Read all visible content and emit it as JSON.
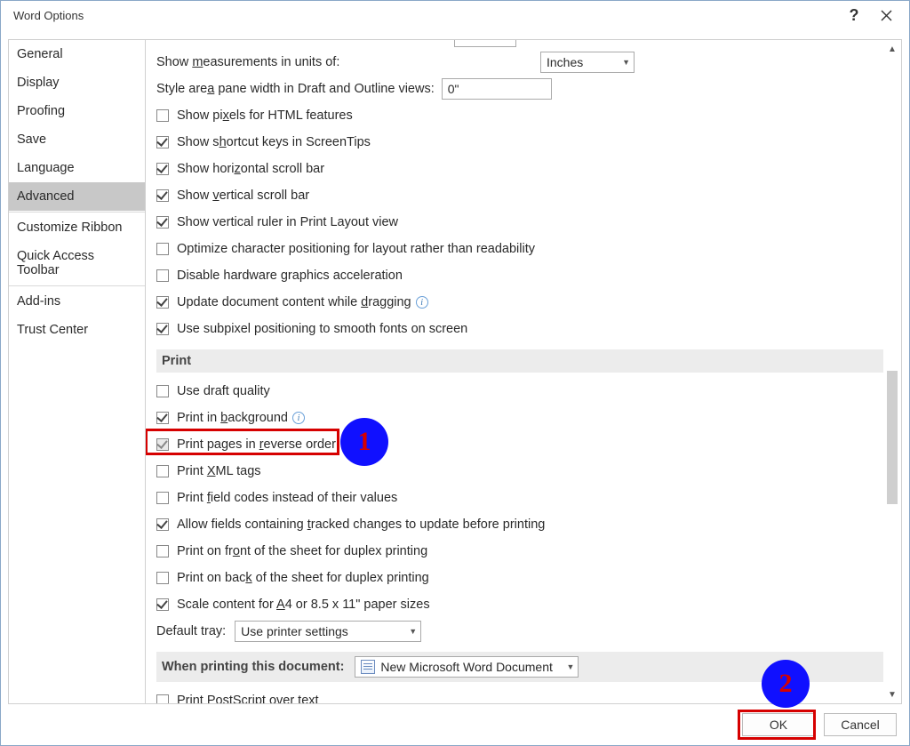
{
  "window": {
    "title": "Word Options"
  },
  "sidebar": {
    "items": [
      "General",
      "Display",
      "Proofing",
      "Save",
      "Language",
      "Advanced",
      "Customize Ribbon",
      "Quick Access Toolbar",
      "Add-ins",
      "Trust Center"
    ],
    "selected_index": 5
  },
  "display_section": {
    "measure_label_pre": "Show ",
    "measure_label_u": "m",
    "measure_label_post": "easurements in units of:",
    "measure_unit": "Inches",
    "style_pane_label_pre": "Style are",
    "style_pane_label_u": "a",
    "style_pane_label_post": " pane width in Draft and Outline views:",
    "style_pane_value": "0\"",
    "cb_pixels_pre": "Show pi",
    "cb_pixels_u": "x",
    "cb_pixels_post": "els for HTML features",
    "cb_shortcut_pre": "Show s",
    "cb_shortcut_u": "h",
    "cb_shortcut_post": "ortcut keys in ScreenTips",
    "cb_hscroll_pre": "Show hori",
    "cb_hscroll_u": "z",
    "cb_hscroll_post": "ontal scroll bar",
    "cb_vscroll_pre": "Show ",
    "cb_vscroll_u": "v",
    "cb_vscroll_post": "ertical scroll bar",
    "cb_vruler": "Show vertical ruler in Print Layout view",
    "cb_optimize": "Optimize character positioning for layout rather than readability",
    "cb_disable_hw": "Disable hardware graphics acceleration",
    "cb_update_drag_pre": "Update document content while ",
    "cb_update_drag_u": "d",
    "cb_update_drag_post": "ragging",
    "cb_subpixel": "Use subpixel positioning to smooth fonts on screen"
  },
  "print_section": {
    "title": "Print",
    "cb_draft": "Use draft quality",
    "cb_background_pre": "Print in ",
    "cb_background_u": "b",
    "cb_background_post": "ackground",
    "cb_reverse_pre": "Print pages in ",
    "cb_reverse_u": "r",
    "cb_reverse_post": "everse order",
    "cb_xml_pre": "Print ",
    "cb_xml_u": "X",
    "cb_xml_post": "ML tags",
    "cb_field_pre": "Print ",
    "cb_field_u": "f",
    "cb_field_post": "ield codes instead of their values",
    "cb_tracked_pre": "Allow fields containing ",
    "cb_tracked_u": "t",
    "cb_tracked_post": "racked changes to update before printing",
    "cb_front_pre": "Print on fr",
    "cb_front_u": "o",
    "cb_front_post": "nt of the sheet for duplex printing",
    "cb_back_pre": "Print on bac",
    "cb_back_u": "k",
    "cb_back_post": " of the sheet for duplex printing",
    "cb_scale_pre": "Scale content for ",
    "cb_scale_u": "A",
    "cb_scale_post": "4 or 8.5 x 11\" paper sizes",
    "tray_label": "Default tray:",
    "tray_value": "Use printer settings"
  },
  "when_printing_section": {
    "title": "When printing this document:",
    "doc_name": "New Microsoft Word Document",
    "cb_post_pre": "Print ",
    "cb_post_u": "P",
    "cb_post_post": "ostScript over text"
  },
  "footer": {
    "ok": "OK",
    "cancel": "Cancel"
  },
  "annotations": {
    "badge1": "1",
    "badge2": "2"
  }
}
